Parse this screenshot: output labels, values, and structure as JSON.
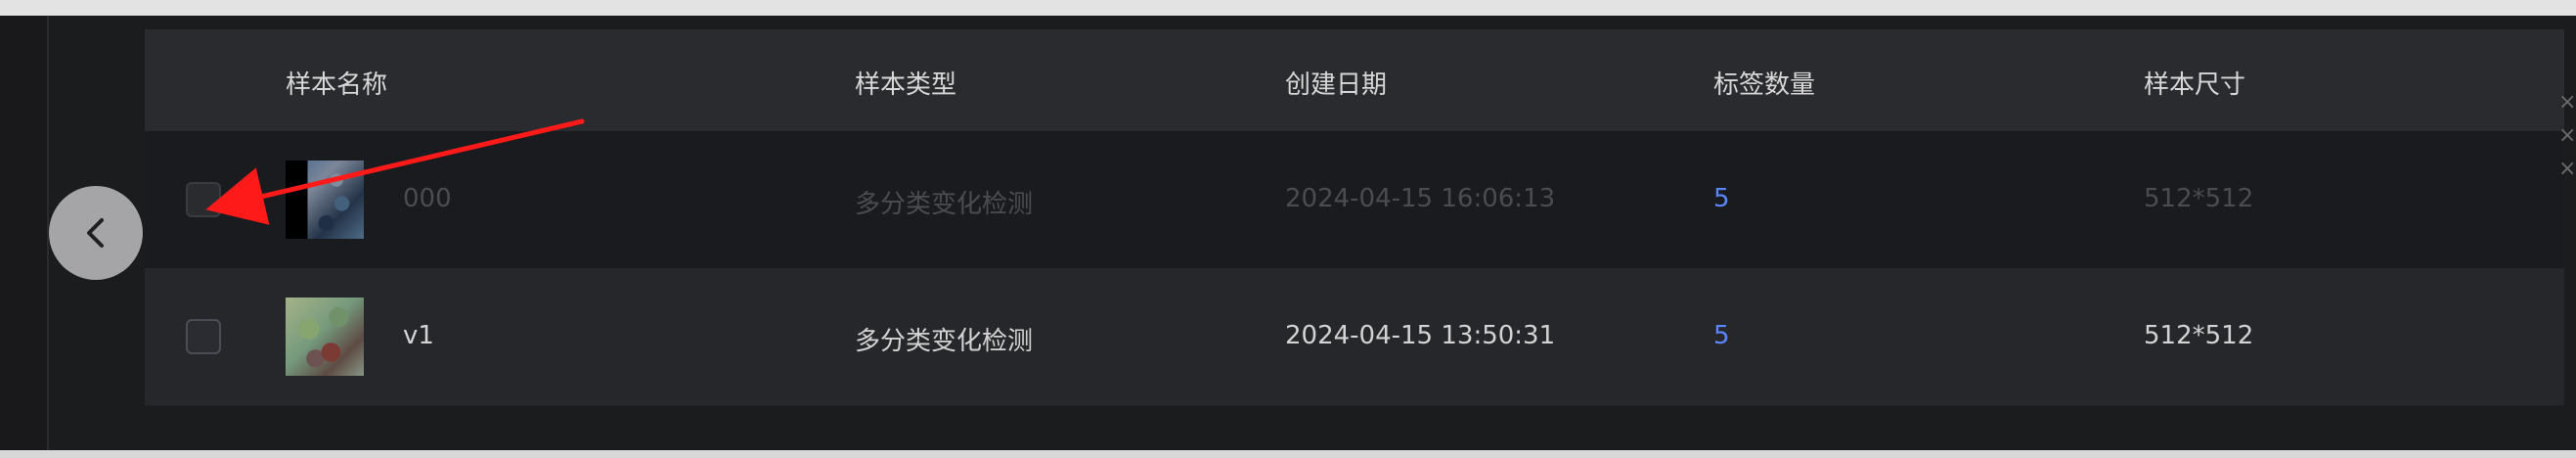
{
  "table": {
    "headers": {
      "sample_name": "样本名称",
      "sample_type": "样本类型",
      "created_date": "创建日期",
      "tag_count": "标签数量",
      "sample_size": "样本尺寸"
    },
    "rows": [
      {
        "name": "000",
        "type": "多分类变化检测",
        "created_date": "2024-04-15 16:06:13",
        "tag_count": "5",
        "size": "512*512"
      },
      {
        "name": "v1",
        "type": "多分类变化检测",
        "created_date": "2024-04-15 13:50:31",
        "tag_count": "5",
        "size": "512*512"
      }
    ]
  },
  "controls": {
    "back_icon": "chevron-left-icon",
    "right_indicator_icon": "close-icon"
  },
  "colors": {
    "header_background": "#2a2b2f",
    "row_background_selected": "#1a1b1e",
    "row_background": "#26272b",
    "tag_count": "#5b86ff",
    "annotation_arrow": "#ff1a1a"
  }
}
